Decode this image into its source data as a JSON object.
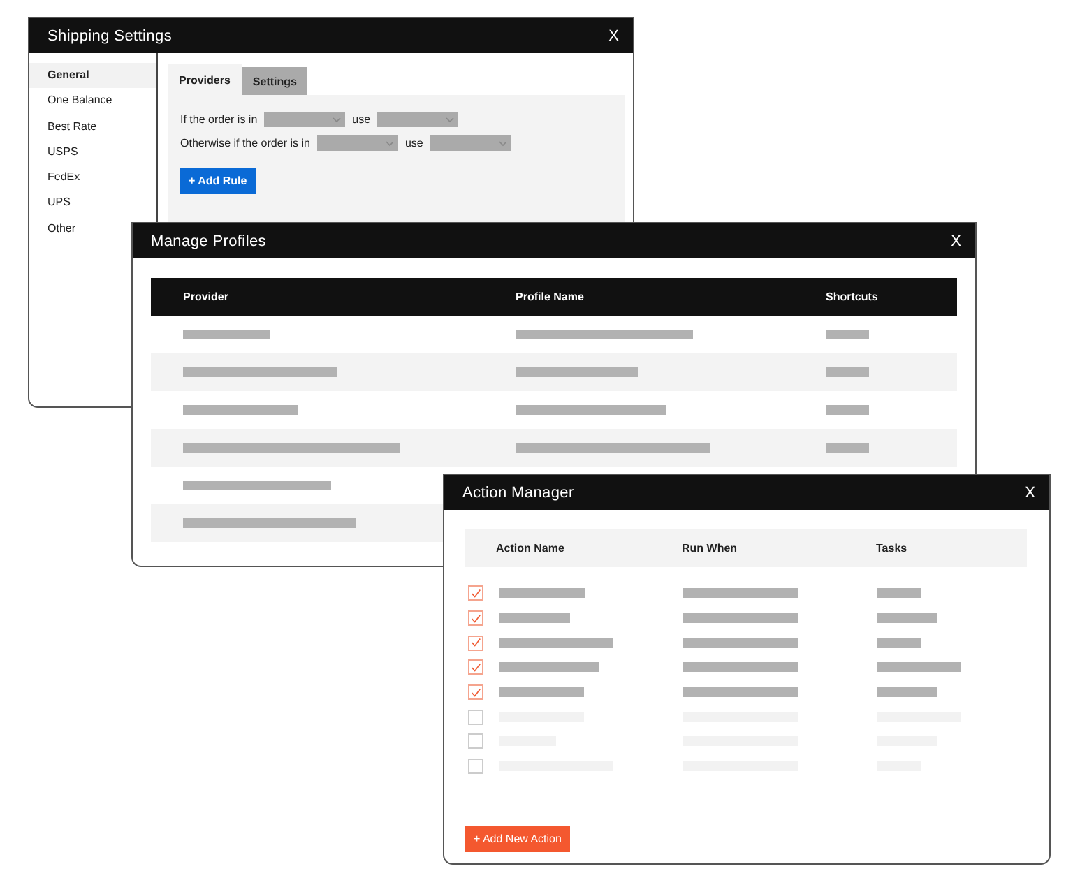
{
  "shipping_settings": {
    "title": "Shipping Settings",
    "close": "X",
    "sidebar": [
      {
        "label": "General",
        "selected": true
      },
      {
        "label": "One Balance",
        "selected": false
      },
      {
        "label": "Best Rate",
        "selected": false
      },
      {
        "label": "USPS",
        "selected": false
      },
      {
        "label": "FedEx",
        "selected": false
      },
      {
        "label": "UPS",
        "selected": false
      },
      {
        "label": "Other",
        "selected": false
      }
    ],
    "tabs": [
      {
        "label": "Providers",
        "selected": true
      },
      {
        "label": "Settings",
        "selected": false
      }
    ],
    "rules": [
      {
        "label": "If the order is in",
        "use": "use"
      },
      {
        "label": "Otherwise if the order is in",
        "use": "use"
      }
    ],
    "add_button": "+ Add Rule"
  },
  "manage_profiles": {
    "title": "Manage Profiles",
    "close": "X",
    "columns": [
      "Provider",
      "Profile Name",
      "Shortcuts"
    ],
    "rows": [
      {
        "striped": false
      },
      {
        "striped": true
      },
      {
        "striped": false
      },
      {
        "striped": true
      },
      {
        "striped": false
      },
      {
        "striped": true
      }
    ]
  },
  "action_manager": {
    "title": "Action Manager",
    "close": "X",
    "columns": [
      "Action Name",
      "Run When",
      "Tasks"
    ],
    "rows": [
      {
        "checked": true
      },
      {
        "checked": true
      },
      {
        "checked": true
      },
      {
        "checked": true
      },
      {
        "checked": true
      },
      {
        "checked": false
      },
      {
        "checked": false
      },
      {
        "checked": false
      }
    ],
    "add_button": "+ Add New Action"
  }
}
